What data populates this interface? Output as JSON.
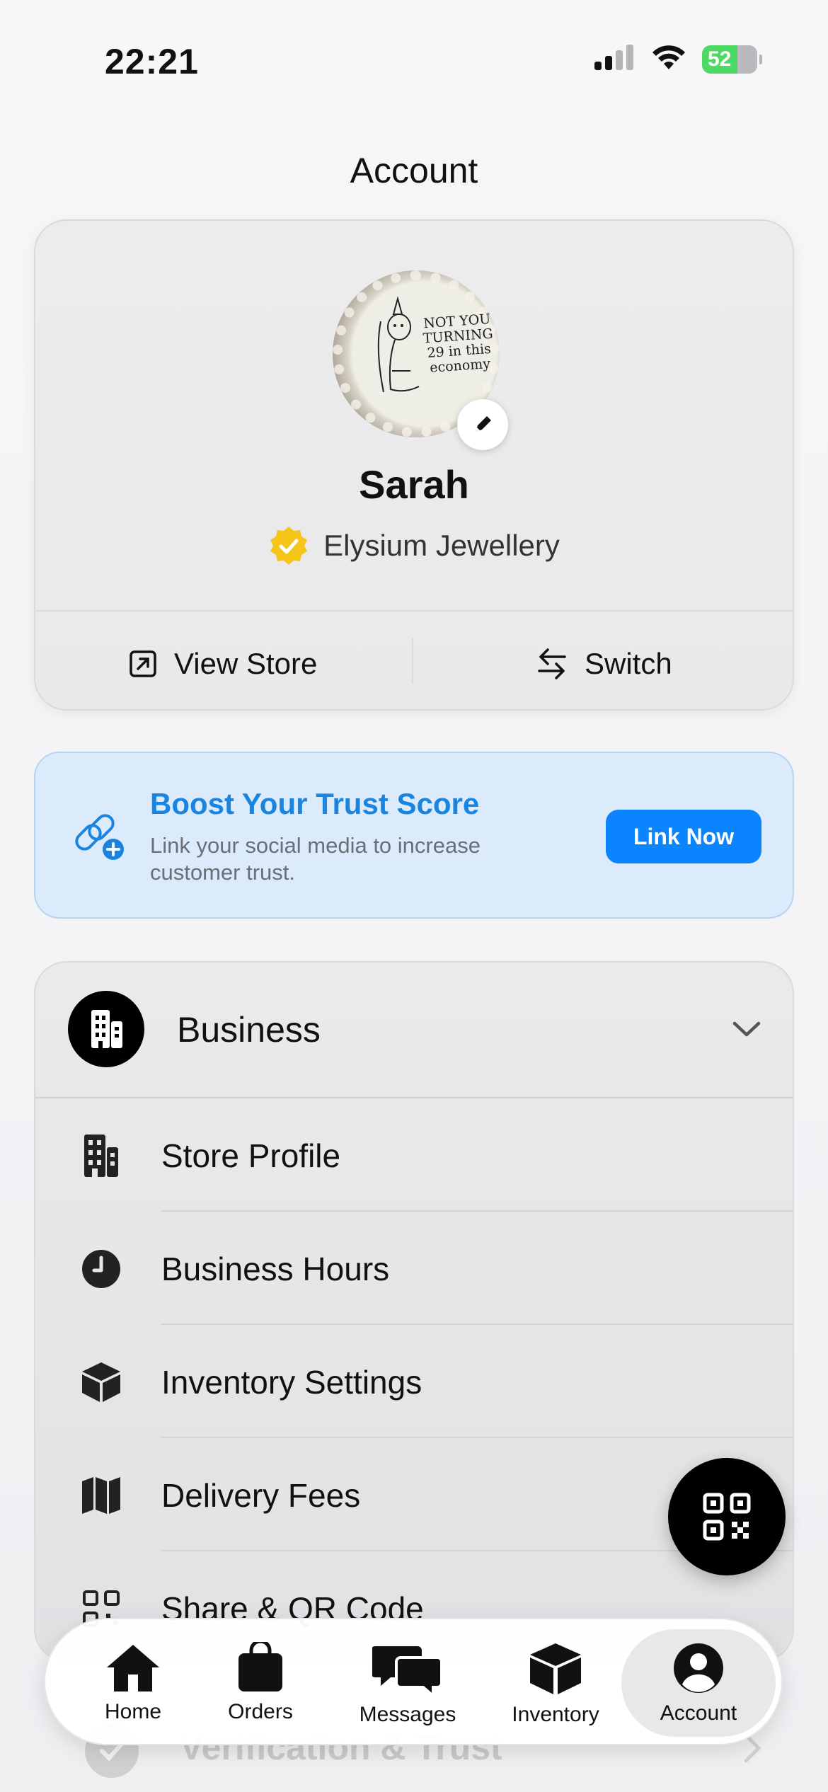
{
  "status": {
    "time": "22:21",
    "battery": "52"
  },
  "header": {
    "title": "Account"
  },
  "profile": {
    "name": "Sarah",
    "store_name": "Elysium Jewellery",
    "avatar_cake_text": "NOT YOU TURNING 29 in this economy",
    "actions": {
      "view_store": "View Store",
      "switch": "Switch"
    }
  },
  "trust_banner": {
    "title": "Boost Your Trust Score",
    "subtitle": "Link your social media to increase customer trust.",
    "button": "Link Now"
  },
  "business": {
    "title": "Business",
    "items": [
      {
        "label": "Store Profile",
        "icon": "building-icon"
      },
      {
        "label": "Business Hours",
        "icon": "clock-icon"
      },
      {
        "label": "Inventory Settings",
        "icon": "box-icon"
      },
      {
        "label": "Delivery Fees",
        "icon": "map-icon"
      },
      {
        "label": "Share & QR Code",
        "icon": "qr-code-icon"
      }
    ]
  },
  "next_section": {
    "label": "Verification & Trust"
  },
  "tabbar": {
    "tabs": [
      {
        "label": "Home",
        "icon": "home-icon"
      },
      {
        "label": "Orders",
        "icon": "bag-icon"
      },
      {
        "label": "Messages",
        "icon": "chat-bubbles-icon"
      },
      {
        "label": "Inventory",
        "icon": "box-icon"
      },
      {
        "label": "Account",
        "icon": "person-circle-icon",
        "active": true
      }
    ]
  },
  "colors": {
    "accent": "#0a84ff",
    "trust_title": "#1a85e0",
    "verified_badge": "#f5c518",
    "battery": "#4cd964"
  }
}
